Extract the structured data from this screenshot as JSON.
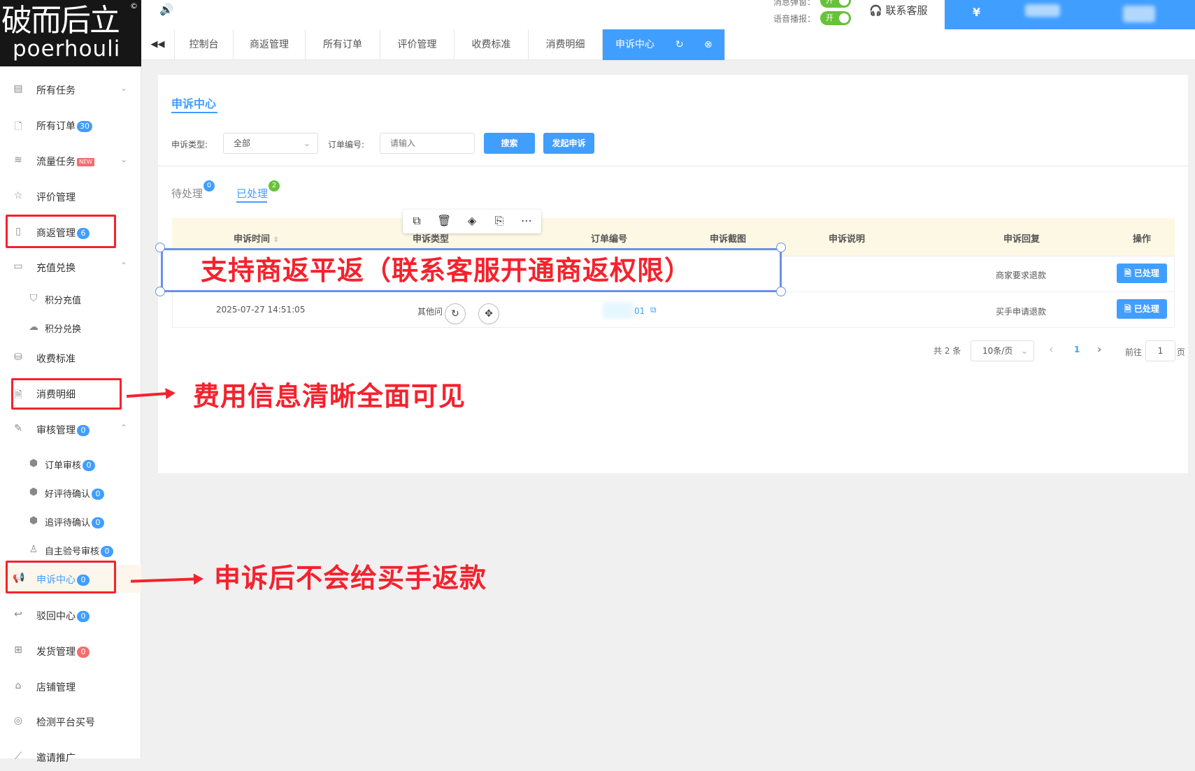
{
  "logo": {
    "cn": "破而后立",
    "en": "poerhouli",
    "reg": "©"
  },
  "topbar": {
    "notice_label": "消息弹窗：",
    "voice_label": "语音播报：",
    "toggle_on": "开",
    "service": "联系客服",
    "currency": "¥"
  },
  "tabs": [
    "控制台",
    "商返管理",
    "所有订单",
    "评价管理",
    "收费标准",
    "消费明细",
    "申诉中心"
  ],
  "sidebar": [
    {
      "label": "所有任务",
      "icon": "doc-icon",
      "chev": "⌄"
    },
    {
      "label": "所有订单",
      "icon": "file-icon",
      "badge": "30"
    },
    {
      "label": "流量任务",
      "icon": "traffic-icon",
      "new": "NEW",
      "chev": "⌄"
    },
    {
      "label": "评价管理",
      "icon": "star-icon"
    },
    {
      "label": "商返管理",
      "icon": "tablet-icon",
      "badge": "6"
    },
    {
      "label": "充值兑换",
      "icon": "card-icon",
      "chev": "⌃"
    },
    {
      "label": "积分充值",
      "icon": "bag-icon",
      "sub": true
    },
    {
      "label": "积分兑换",
      "icon": "cloud-icon",
      "sub": true
    },
    {
      "label": "收费标准",
      "icon": "coins-icon"
    },
    {
      "label": "消费明细",
      "icon": "receipt-icon"
    },
    {
      "label": "审核管理",
      "icon": "edit-icon",
      "badge": "0",
      "chev": "⌃"
    },
    {
      "label": "订单审核",
      "icon": "hex-icon",
      "badge": "0",
      "sub": true
    },
    {
      "label": "好评待确认",
      "icon": "hex-icon",
      "badge": "0",
      "sub": true
    },
    {
      "label": "追评待确认",
      "icon": "hex-icon",
      "badge": "0",
      "sub": true
    },
    {
      "label": "自主验号审核",
      "icon": "user-icon",
      "badge": "0",
      "sub": true
    },
    {
      "label": "申诉中心",
      "icon": "megaphone-icon",
      "badge": "0",
      "active": true
    },
    {
      "label": "驳回中心",
      "icon": "reply-icon",
      "badge": "0"
    },
    {
      "label": "发货管理",
      "icon": "box-icon",
      "badge": "0",
      "badgeRed": true
    },
    {
      "label": "店铺管理",
      "icon": "shop-icon"
    },
    {
      "label": "检测平台买号",
      "icon": "scan-icon"
    },
    {
      "label": "邀请推广",
      "icon": "share-icon"
    }
  ],
  "content": {
    "title": "申诉中心",
    "filter_type_label": "申诉类型:",
    "filter_type_value": "全部",
    "order_label": "订单编号:",
    "order_placeholder": "请输入",
    "search_btn": "搜索",
    "appeal_btn": "发起申诉",
    "subtab_pending": "待处理",
    "subtab_pending_count": "0",
    "subtab_done": "已处理",
    "subtab_done_count": "2"
  },
  "table": {
    "headers": [
      "申诉时间",
      "申诉类型",
      "订单编号",
      "申诉截图",
      "申诉说明",
      "申诉回复",
      "操作"
    ],
    "rows": [
      {
        "time": "",
        "type": "",
        "order": "",
        "reply": "商家要求退款",
        "action": "已处理"
      },
      {
        "time": "2025-07-27 14:51:05",
        "type": "其他问",
        "order": "01",
        "reply": "买手申请退款",
        "action": "已处理"
      }
    ]
  },
  "pagination": {
    "total": "共 2 条",
    "per_page": "10条/页",
    "prev": "‹",
    "current": "1",
    "next": "›",
    "goto": "前往",
    "goto_value": "1",
    "page_unit": "页"
  },
  "toolbar_icons": [
    "copy-icon",
    "trash-icon",
    "layers-icon",
    "replace-icon",
    "more-icon"
  ],
  "annotations": {
    "banner": "支持商返平返（联系客服开通商返权限）",
    "cost": "费用信息清晰全面可见",
    "appeal": "申诉后不会给买手返款"
  },
  "colors": {
    "primary": "#409eff",
    "annotation": "#f5222d",
    "toggle": "#67c23a",
    "header_bg": "#fcf8e3"
  }
}
